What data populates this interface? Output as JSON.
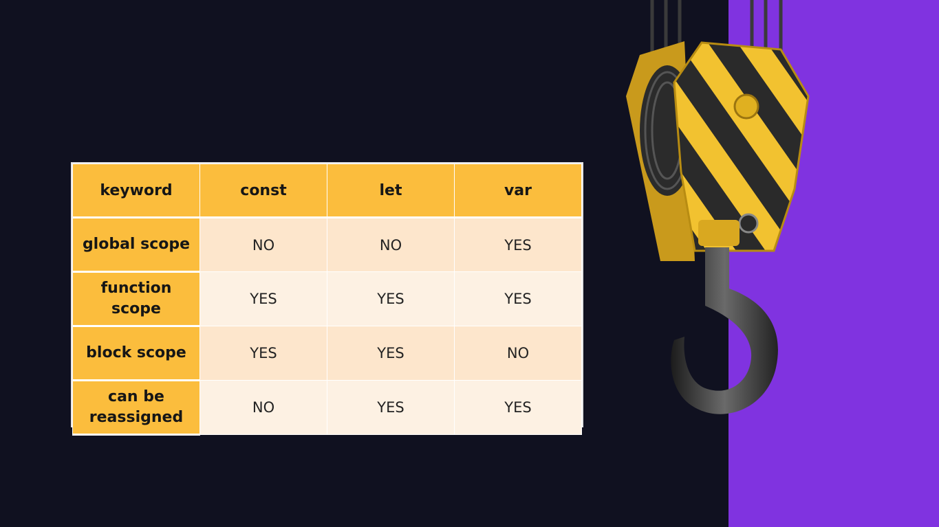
{
  "table": {
    "headers": [
      "keyword",
      "const",
      "let",
      "var"
    ],
    "rows": [
      {
        "label": "global scope",
        "values": [
          "NO",
          "NO",
          "YES"
        ]
      },
      {
        "label": "function scope",
        "values": [
          "YES",
          "YES",
          "YES"
        ]
      },
      {
        "label": "block scope",
        "values": [
          "YES",
          "YES",
          "NO"
        ]
      },
      {
        "label": "can be reassigned",
        "values": [
          "NO",
          "YES",
          "YES"
        ]
      }
    ]
  },
  "colors": {
    "background": "#101120",
    "accent_panel": "#8033e0",
    "header_fill": "#fbbd3d",
    "row_light": "#fdf1e3",
    "row_dark": "#fde6cc"
  },
  "illustration": {
    "icon": "crane-hook-icon"
  }
}
